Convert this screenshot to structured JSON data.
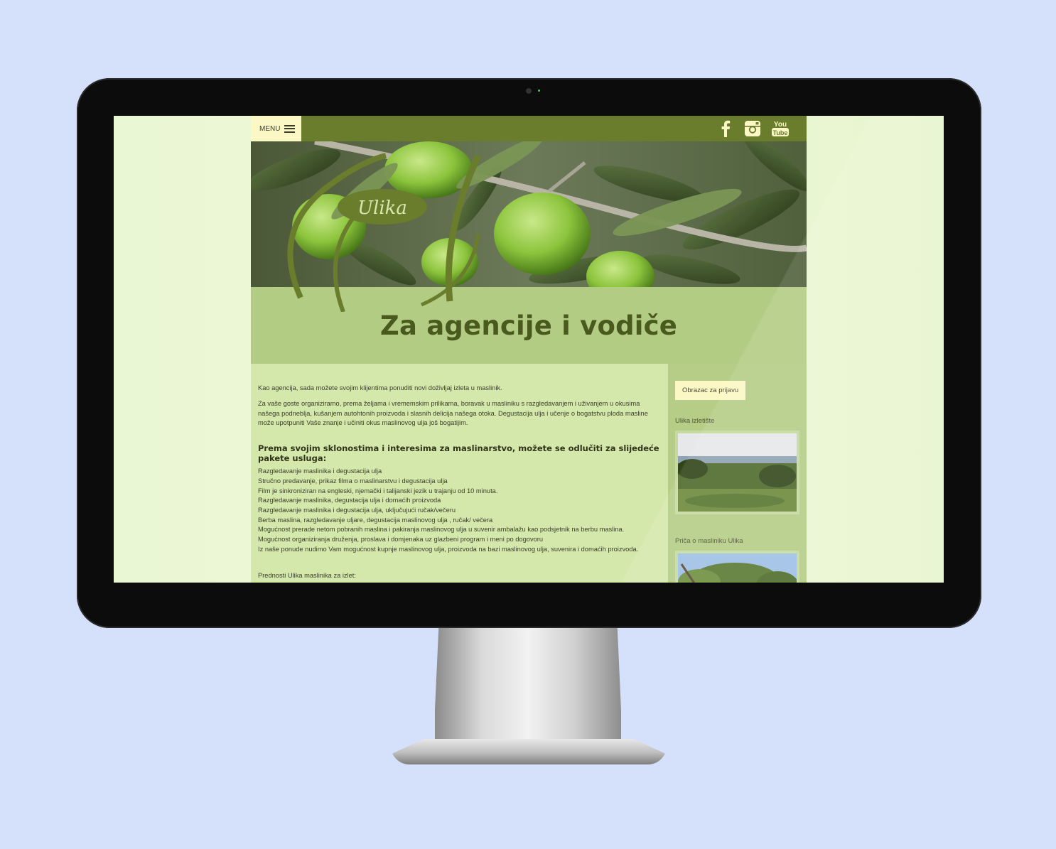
{
  "nav": {
    "menu_label": "MENU"
  },
  "social": [
    "facebook-icon",
    "instagram-icon",
    "youtube-icon"
  ],
  "youtube": {
    "line1": "You",
    "line2": "Tube"
  },
  "brand": {
    "logo_text": "Ulika"
  },
  "page": {
    "title": "Za agencije i vodiče"
  },
  "content": {
    "intro": "Kao agencija, sada možete svojim klijentima ponuditi novi doživljaj izleta u maslinik.",
    "para2": "Za vaše goste organiziramo, prema željama i vrememskim prilikama, boravak u masliniku s razgledavanjem i uživanjem u okusima našega podneblja, kušanjem autohtonih proizvoda i slasnih delicija našega otoka. Degustacija ulja i učenje o bogatstvu ploda masline može upotpuniti Vaše znanje i učiniti okus maslinovog ulja još bogatijim.",
    "heading": "Prema svojim sklonostima i interesima za maslinarstvo, možete se odlučiti za slijedeće pakete usluga:",
    "services": [
      "Razgledavanje maslinika i degustacija ulja",
      "Stručno predavanje, prikaz filma o maslinarstvu i degustacija ulja",
      "Film je sinkroniziran na engleski, njemački i talijanski jezik u trajanju od 10 minuta.",
      "Razgledavanje maslinika, degustacija ulja i domaćih proizvoda",
      "Razgledavanje maslinika i degustacija ulja, uključujući ručak/večeru",
      "Berba maslina, razgledavanje uljare, degustacija maslinovog ulja , ručak/ večera",
      "Mogućnost prerade netom pobranih maslina i pakiranja maslinovog ulja u suvenir ambalažu kao podsjetnik na berbu maslina.",
      "Mogućnost organiziranja druženja, proslava i domjenaka uz glazbeni program i meni po dogovoru",
      "Iz naše ponude nudimo Vam mogućnost kupnje maslinovog ulja, proizvoda na bazi maslinovog ulja, suvenira i domaćih proizvoda."
    ],
    "partial": "Prednosti Ulika maslinika za izlet:"
  },
  "sidebar": {
    "apply_button": "Obrazac za prijavu",
    "gallery1_label": "Ulika izletište",
    "gallery2_label": "Priča o masliniku Ulika"
  },
  "colors": {
    "page_bg": "#d5e0fa",
    "topbar": "#6a7d2c",
    "title_band": "#b3cc84",
    "content_bg": "#d5e8ac",
    "sidebar_bg": "#b5cd87",
    "button_bg": "#fbf8c5",
    "title_text": "#4a5a1f"
  }
}
